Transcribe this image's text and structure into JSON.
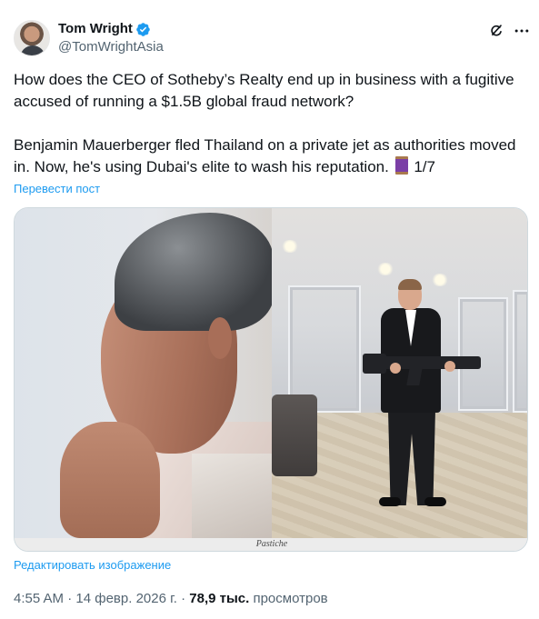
{
  "author": {
    "display_name": "Tom Wright",
    "handle": "@TomWrightAsia",
    "verified": true
  },
  "header_icons": [
    "grok-icon",
    "more-icon"
  ],
  "tweet": {
    "paragraph_1": "How does the CEO of Sotheby’s Realty end up in business with a fugitive accused of running a $1.5B global fraud network?",
    "paragraph_2": "Benjamin Mauerberger fled Thailand on a private jet as authorities moved in. Now, he's using Dubai's elite to wash his reputation.",
    "thread_counter": "1/7"
  },
  "translate_label": "Перевести пост",
  "media": {
    "caption": "Pastiche"
  },
  "edit_image_label": "Редактировать изображение",
  "meta": {
    "time": "4:55 AM",
    "separator": " · ",
    "date": "14 февр. 2026 г.",
    "views_count": "78,9 тыс.",
    "views_label": "просмотров"
  },
  "colors": {
    "link": "#1d9bf0",
    "verified_badge": "#1d9bf0",
    "secondary_text": "#536471",
    "primary_text": "#0f1419"
  }
}
